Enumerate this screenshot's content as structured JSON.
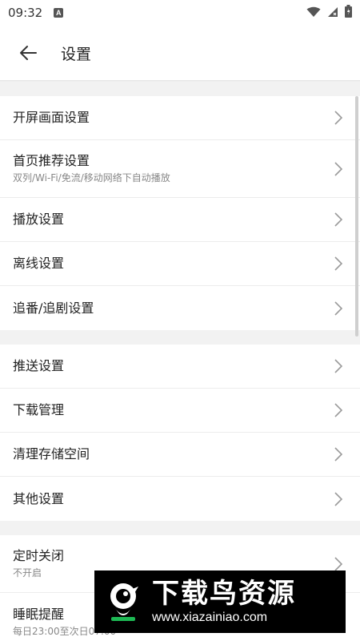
{
  "status_bar": {
    "time": "09:32",
    "notification_icon": "A"
  },
  "header": {
    "title": "设置"
  },
  "groups": [
    {
      "items": [
        {
          "label": "开屏画面设置",
          "sub": ""
        },
        {
          "label": "首页推荐设置",
          "sub": "双列/Wi-Fi/免流/移动网络下自动播放"
        },
        {
          "label": "播放设置",
          "sub": ""
        },
        {
          "label": "离线设置",
          "sub": ""
        },
        {
          "label": "追番/追剧设置",
          "sub": ""
        }
      ]
    },
    {
      "items": [
        {
          "label": "推送设置",
          "sub": ""
        },
        {
          "label": "下载管理",
          "sub": ""
        },
        {
          "label": "清理存储空间",
          "sub": ""
        },
        {
          "label": "其他设置",
          "sub": ""
        }
      ]
    },
    {
      "items": [
        {
          "label": "定时关闭",
          "sub": "不开启"
        },
        {
          "label": "睡眠提醒",
          "sub": "每日23:00至次日07:00"
        }
      ]
    }
  ],
  "watermark": {
    "title": "下载鸟资源",
    "url": "www.xiazainiao.com"
  },
  "colors": {
    "background": "#f2f2f2",
    "row_background": "#ffffff",
    "text_primary": "#222222",
    "text_secondary": "#888888",
    "chevron": "#9a9a9a"
  }
}
